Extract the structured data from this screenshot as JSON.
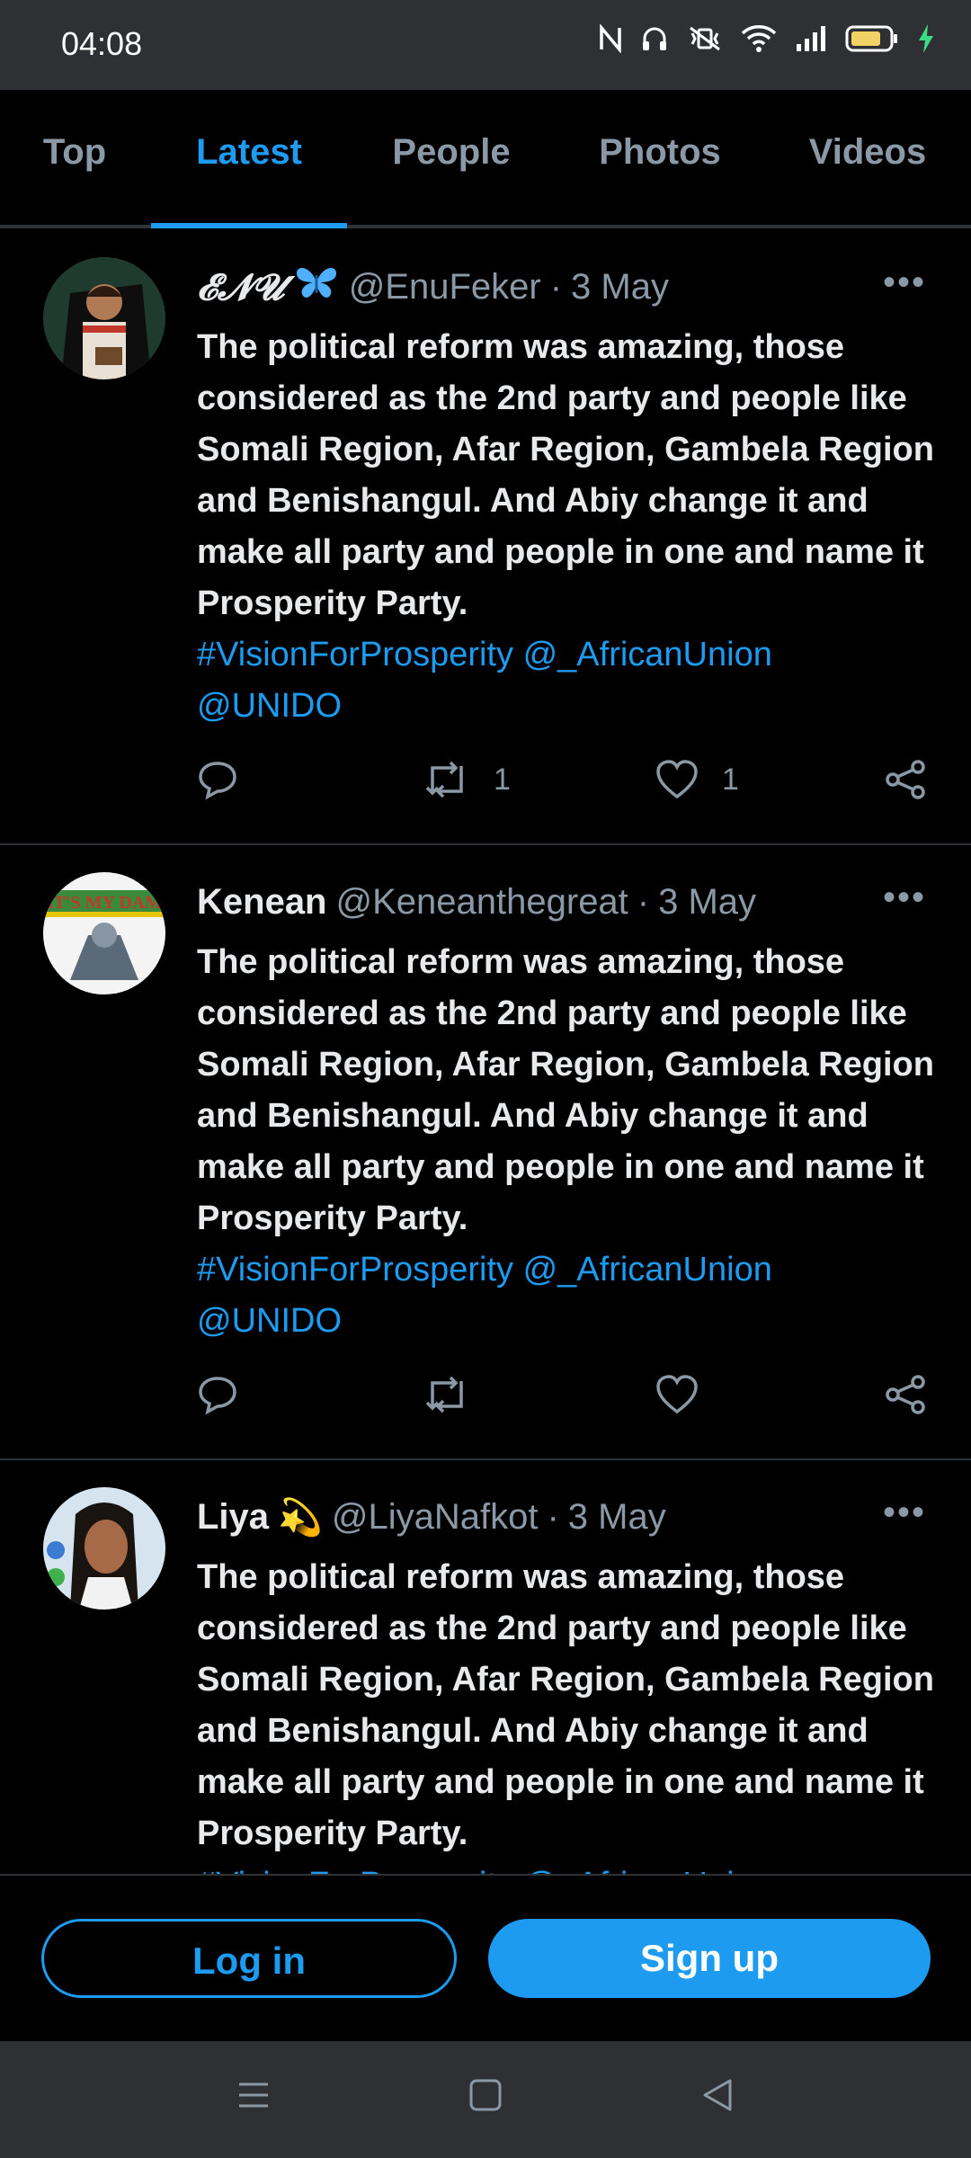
{
  "status_bar": {
    "time": "04:08",
    "icons": [
      "nfc-icon",
      "headphones-icon",
      "vibrate-icon",
      "wifi-icon",
      "signal-icon",
      "battery-icon",
      "charging-icon"
    ]
  },
  "tabs": [
    {
      "label": "Top",
      "active": false
    },
    {
      "label": "Latest",
      "active": true
    },
    {
      "label": "People",
      "active": false
    },
    {
      "label": "Photos",
      "active": false
    },
    {
      "label": "Videos",
      "active": false
    }
  ],
  "tweets": [
    {
      "name": "𝓔𝓝𝓤",
      "name_emoji": "butterfly",
      "handle": "@EnuFeker",
      "date": "3 May",
      "text": "The political reform was amazing, those considered as the 2nd party and people like Somali Region, Afar Region, Gambela Region and Benishangul. And Abiy change it and make all party and people in one and name it Prosperity Party.",
      "hashtag": "#VisionForProsperity",
      "mention1": "@_AfricanUnion",
      "mention2": "@UNIDO",
      "retweets": "1",
      "likes": "1"
    },
    {
      "name": "Kenean",
      "handle": "@Keneanthegreat",
      "date": "3 May",
      "text": "The political reform was amazing, those considered as the 2nd party and people like Somali Region, Afar Region, Gambela Region and Benishangul. And Abiy change it and make all party and people in one and name it Prosperity Party.",
      "hashtag": "#VisionForProsperity",
      "mention1": "@_AfricanUnion",
      "mention2": "@UNIDO",
      "retweets": "",
      "likes": ""
    },
    {
      "name": "Liya",
      "name_emoji": "💫",
      "handle": "@LiyaNafkot",
      "date": "3 May",
      "text": "The political reform was amazing, those considered as the 2nd party and people like Somali Region, Afar Region, Gambela Region and Benishangul. And Abiy change it and make all party and people in one and name it Prosperity Party.",
      "hashtag": "#VisionForProsperity",
      "mention1": "@_AfricanUnion",
      "mention2": "",
      "retweets": "",
      "likes": ""
    }
  ],
  "auth": {
    "login_label": "Log in",
    "signup_label": "Sign up"
  },
  "colors": {
    "accent": "#1d9bf0",
    "background": "#000000",
    "muted": "#8b98a5",
    "text": "#e7e9ea",
    "system_bar": "#2f3033"
  }
}
